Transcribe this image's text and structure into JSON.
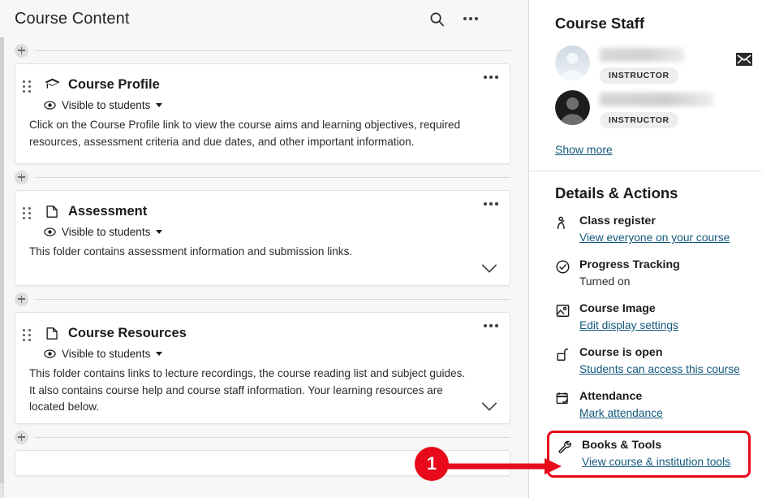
{
  "header": {
    "title": "Course Content",
    "search_icon": "search-icon",
    "more_icon": "more-options-icon"
  },
  "content_items": [
    {
      "icon": "graduation-cap-icon",
      "title": "Course Profile",
      "visibility": "Visible to students",
      "description": "Click on the Course Profile link to view the course aims and learning objectives, required resources, assessment criteria and due dates, and other important information.",
      "expandable": false
    },
    {
      "icon": "folder-icon",
      "title": "Assessment",
      "visibility": "Visible to students",
      "description": "This folder contains assessment information and submission links.",
      "expandable": true
    },
    {
      "icon": "folder-icon",
      "title": "Course Resources",
      "visibility": "Visible to students",
      "description": "This folder contains links to lecture recordings, the course reading list and subject guides. It also contains course help and course staff information. Your learning resources are located below.",
      "expandable": true
    }
  ],
  "sidebar": {
    "staff": {
      "title": "Course Staff",
      "members": [
        {
          "name": "",
          "role": "INSTRUCTOR",
          "avatar": "avatar-light"
        },
        {
          "name": "",
          "role": "INSTRUCTOR",
          "avatar": "avatar-dark"
        }
      ],
      "show_more_label": "Show more",
      "mail_icon": "email-icon"
    },
    "details": {
      "title": "Details & Actions",
      "items": [
        {
          "icon": "class-register-icon",
          "name": "Class register",
          "sub": "View everyone on your course",
          "sub_is_link": true
        },
        {
          "icon": "check-circle-icon",
          "name": "Progress Tracking",
          "sub": "Turned on",
          "sub_is_link": false
        },
        {
          "icon": "image-icon",
          "name": "Course Image",
          "sub": "Edit display settings",
          "sub_is_link": true
        },
        {
          "icon": "unlock-icon",
          "name": "Course is open",
          "sub": "Students can access this course",
          "sub_is_link": true
        },
        {
          "icon": "calendar-check-icon",
          "name": "Attendance",
          "sub": "Mark attendance",
          "sub_is_link": true
        },
        {
          "icon": "wrench-icon",
          "name": "Books & Tools",
          "sub": "View course & institution tools",
          "sub_is_link": true,
          "highlighted": true
        }
      ]
    }
  },
  "annotation": {
    "badge_number": "1",
    "color": "#e8091a"
  },
  "colors": {
    "link": "#14597c",
    "accent_red": "#e8091a",
    "page_bg": "#f7f7f7",
    "card_bg": "#ffffff"
  }
}
